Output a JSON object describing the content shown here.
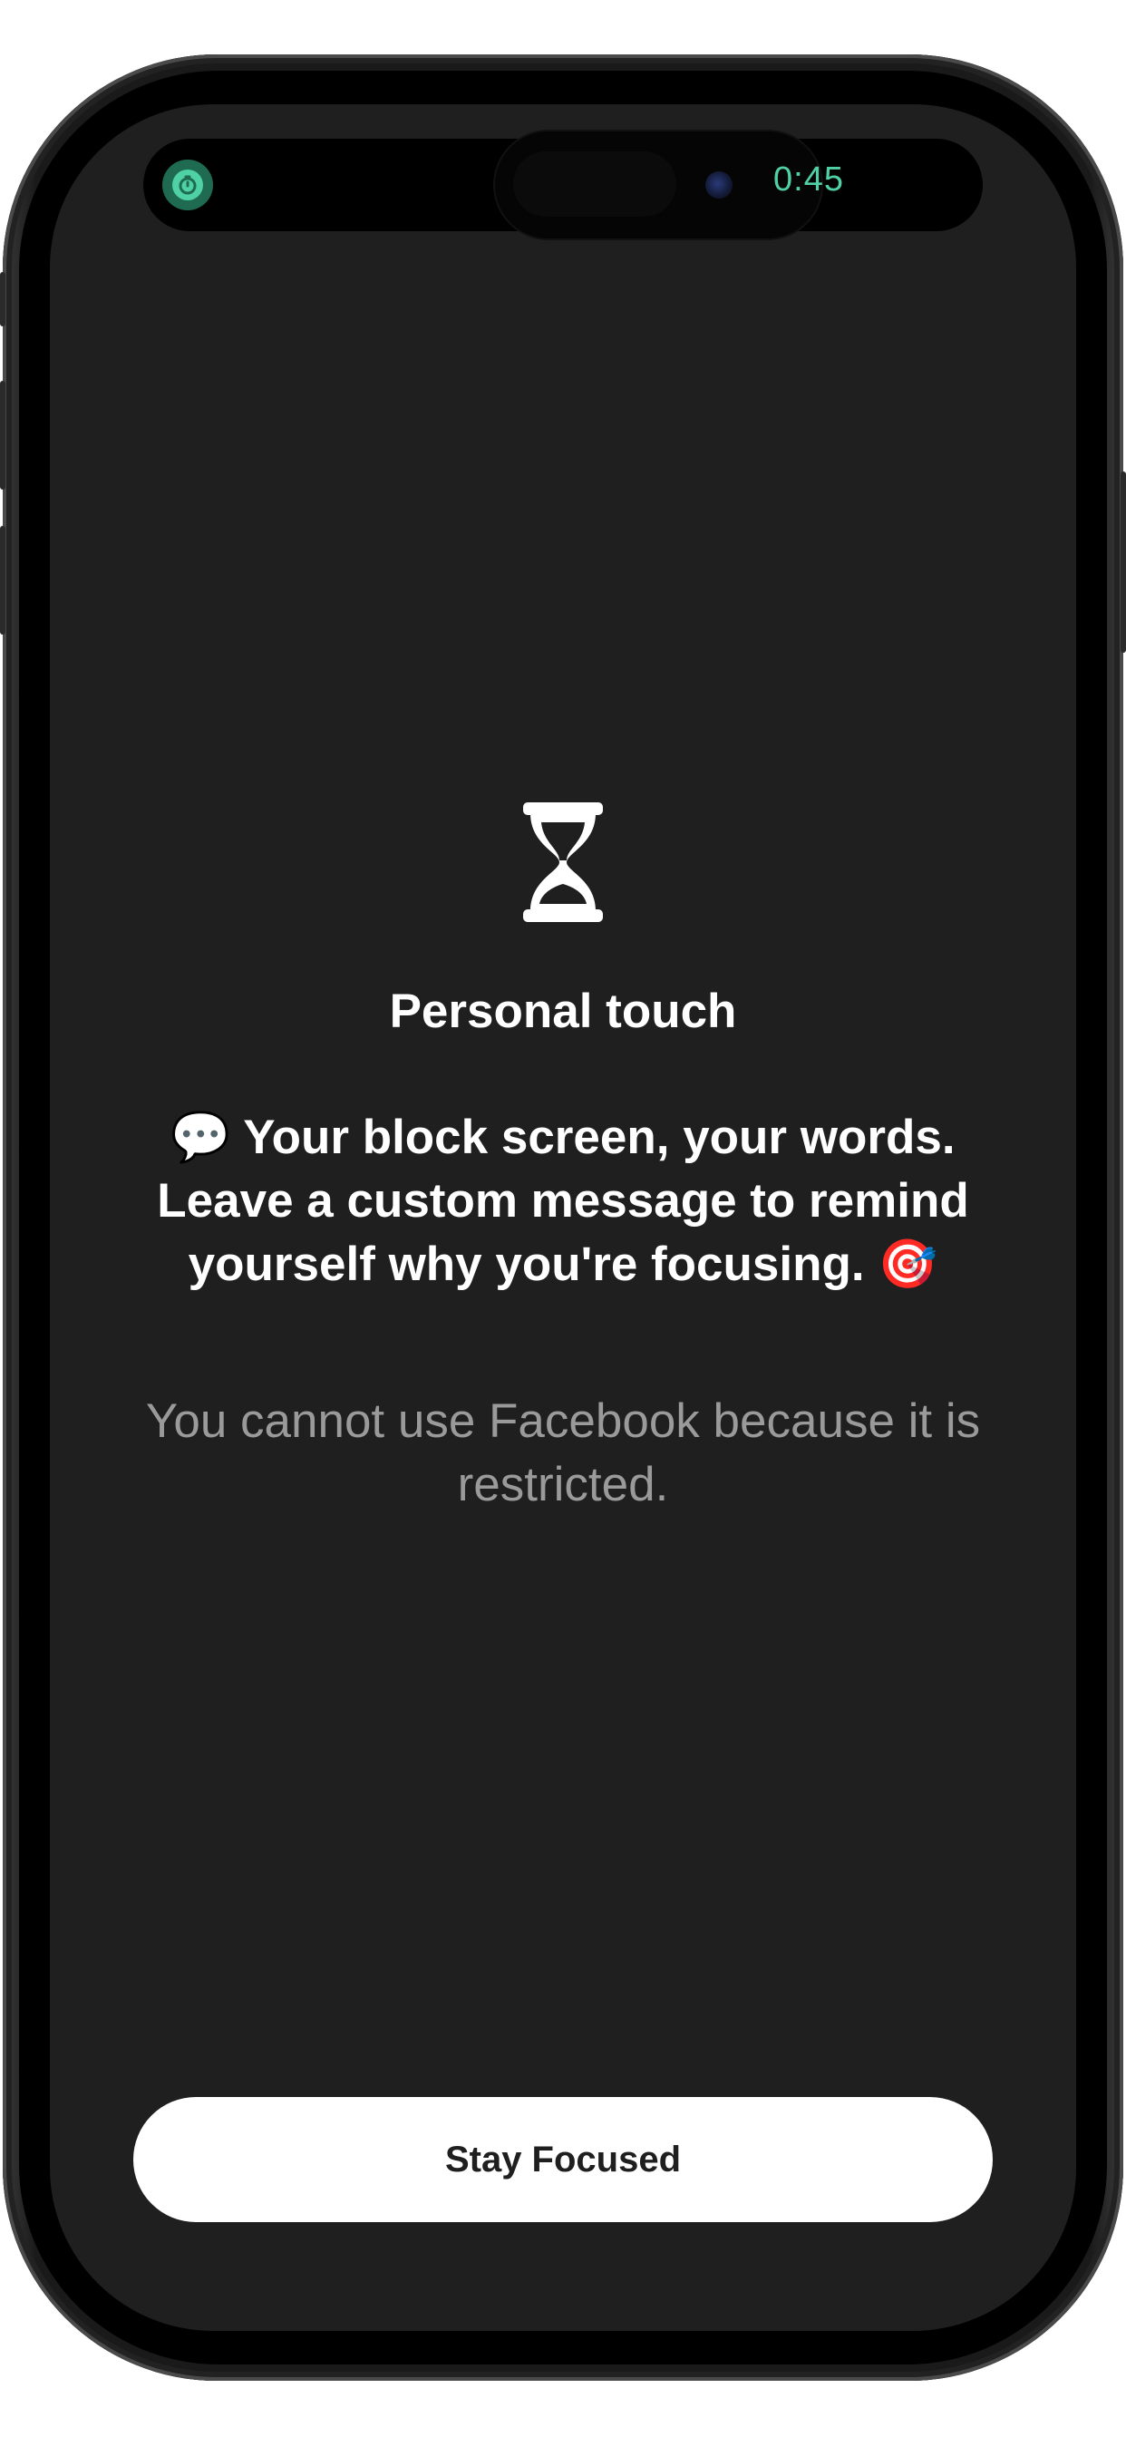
{
  "status_bar": {
    "timer": "0:45",
    "timer_icon": "timer-icon",
    "accent_color": "#4fd1a5"
  },
  "block_screen": {
    "icon": "hourglass-icon",
    "title": "Personal touch",
    "message_emoji_start": "💬",
    "message": "Your block screen, your words. Leave a custom message to remind yourself why you're focusing.",
    "message_emoji_end": "🎯",
    "restriction": "You cannot use Facebook because it is restricted."
  },
  "actions": {
    "stay_focused_label": "Stay Focused"
  },
  "colors": {
    "background": "#1f1f1f",
    "button_background": "#ffffff",
    "secondary_text": "#9a9a9a"
  }
}
